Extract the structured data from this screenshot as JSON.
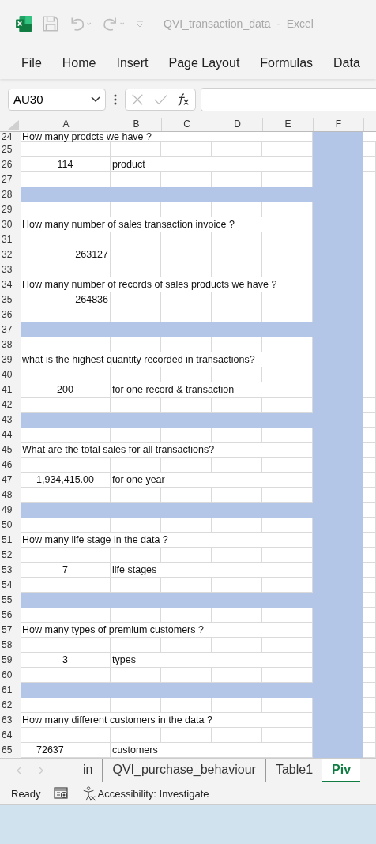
{
  "window": {
    "title": "QVI_transaction_data  -  Excel"
  },
  "ribbon_tabs": [
    "File",
    "Home",
    "Insert",
    "Page Layout",
    "Formulas",
    "Data"
  ],
  "name_box": {
    "value": "AU30"
  },
  "columns": [
    "A",
    "B",
    "C",
    "D",
    "E",
    "F"
  ],
  "rows": [
    {
      "number": "24",
      "kind": "question",
      "a": "How many prodcts we have ?"
    },
    {
      "number": "25",
      "kind": "blank"
    },
    {
      "number": "26",
      "kind": "value",
      "a": {
        "text": "114",
        "kind": "centered"
      },
      "b": "product"
    },
    {
      "number": "27",
      "kind": "blank"
    },
    {
      "number": "28",
      "kind": "band"
    },
    {
      "number": "29",
      "kind": "blank"
    },
    {
      "number": "30",
      "kind": "question",
      "a": "How many number of sales transaction invoice ?"
    },
    {
      "number": "31",
      "kind": "blank"
    },
    {
      "number": "32",
      "kind": "value",
      "a": {
        "text": "263127",
        "kind": "right"
      }
    },
    {
      "number": "33",
      "kind": "blank"
    },
    {
      "number": "34",
      "kind": "question",
      "a": "How many number of records of sales products we have ?"
    },
    {
      "number": "35",
      "kind": "value",
      "a": {
        "text": "264836",
        "kind": "right"
      }
    },
    {
      "number": "36",
      "kind": "blank"
    },
    {
      "number": "37",
      "kind": "band"
    },
    {
      "number": "38",
      "kind": "blank"
    },
    {
      "number": "39",
      "kind": "question",
      "a": "what is the highest quantity recorded in transactions?"
    },
    {
      "number": "40",
      "kind": "blank"
    },
    {
      "number": "41",
      "kind": "value",
      "a": {
        "text": "200",
        "kind": "centered"
      },
      "b": "for one record & transaction"
    },
    {
      "number": "42",
      "kind": "blank"
    },
    {
      "number": "43",
      "kind": "band"
    },
    {
      "number": "44",
      "kind": "blank"
    },
    {
      "number": "45",
      "kind": "question",
      "a": "What are the total sales for all transactions?"
    },
    {
      "number": "46",
      "kind": "blank"
    },
    {
      "number": "47",
      "kind": "value",
      "a": {
        "text": "1,934,415.00",
        "kind": "centered"
      },
      "b": "for one year"
    },
    {
      "number": "48",
      "kind": "blank"
    },
    {
      "number": "49",
      "kind": "band"
    },
    {
      "number": "50",
      "kind": "blank"
    },
    {
      "number": "51",
      "kind": "question",
      "a": "How many life stage in the data ?"
    },
    {
      "number": "52",
      "kind": "blank"
    },
    {
      "number": "53",
      "kind": "value",
      "a": {
        "text": "7",
        "kind": "centered"
      },
      "b": "life stages"
    },
    {
      "number": "54",
      "kind": "blank"
    },
    {
      "number": "55",
      "kind": "band"
    },
    {
      "number": "56",
      "kind": "blank"
    },
    {
      "number": "57",
      "kind": "question",
      "a": "How many types of premium customers ?"
    },
    {
      "number": "58",
      "kind": "blank"
    },
    {
      "number": "59",
      "kind": "value",
      "a": {
        "text": "3",
        "kind": "centered"
      },
      "b": "types"
    },
    {
      "number": "60",
      "kind": "blank"
    },
    {
      "number": "61",
      "kind": "band"
    },
    {
      "number": "62",
      "kind": "blank"
    },
    {
      "number": "63",
      "kind": "question",
      "a": "How many different customers in the data ?"
    },
    {
      "number": "64",
      "kind": "blank"
    },
    {
      "number": "65",
      "kind": "value",
      "a": {
        "text": "72637",
        "kind": "indented"
      },
      "b": "customers"
    }
  ],
  "sheet_tabs": [
    {
      "label": "in",
      "selected": false
    },
    {
      "label": "QVI_purchase_behaviour",
      "selected": false
    },
    {
      "label": "Table1",
      "selected": false
    },
    {
      "label": "Piv",
      "selected": true
    }
  ],
  "status_bar": {
    "mode": "Ready",
    "accessibility": "Accessibility: Investigate"
  }
}
